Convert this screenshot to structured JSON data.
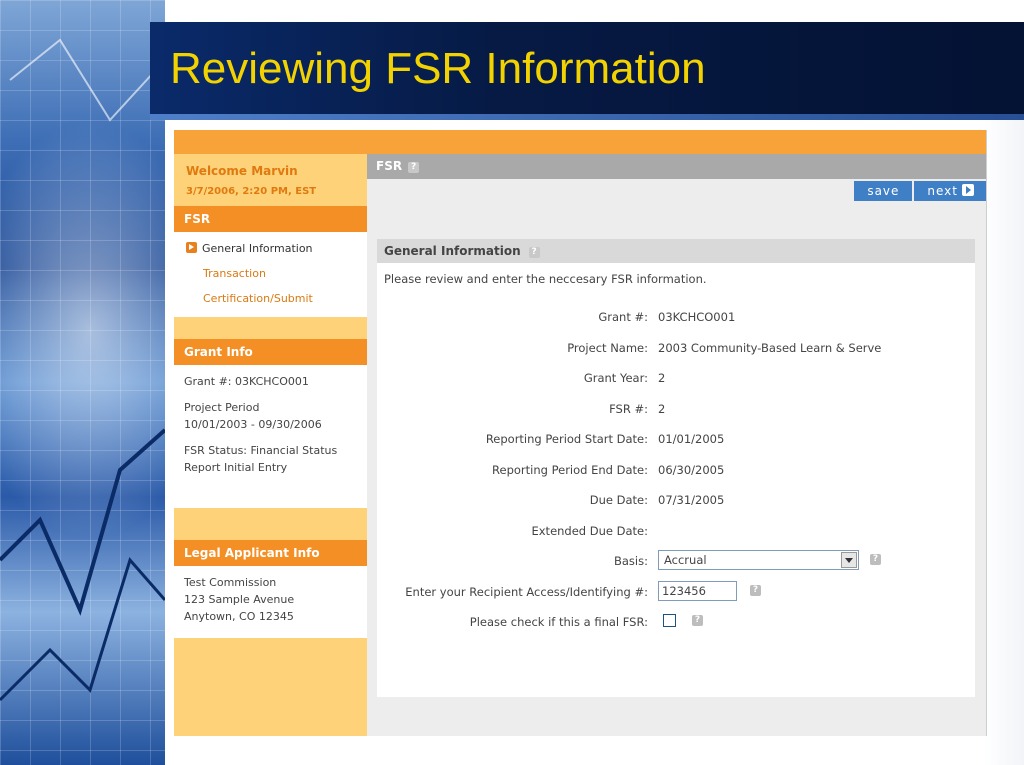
{
  "slide": {
    "title": "Reviewing FSR Information"
  },
  "sidebar": {
    "welcome": "Welcome Marvin",
    "datetime": "3/7/2006, 2:20 PM, EST",
    "fsr_header": "FSR",
    "nav": [
      {
        "label": "General Information",
        "active": true
      },
      {
        "label": "Transaction",
        "active": false
      },
      {
        "label": "Certification/Submit",
        "active": false
      }
    ],
    "grant_header": "Grant Info",
    "grant_lines": {
      "grant": "Grant #: 03KCHCO001",
      "period_label": "Project Period",
      "period_value": "10/01/2003 - 09/30/2006",
      "status_1": "FSR Status: Financial Status",
      "status_2": "Report Initial Entry"
    },
    "legal_header": "Legal Applicant Info",
    "legal_lines": [
      "Test Commission",
      "123 Sample Avenue",
      "Anytown, CO 12345"
    ]
  },
  "main": {
    "bar_title": "FSR",
    "help_glyph": "?",
    "save_label": "save",
    "next_label": "next",
    "panel_title": "General Information",
    "intro": "Please review and enter the neccesary FSR information.",
    "fields": [
      {
        "label": "Grant #:",
        "value": "03KCHCO001"
      },
      {
        "label": "Project Name:",
        "value": "2003 Community-Based Learn & Serve"
      },
      {
        "label": "Grant Year:",
        "value": "2"
      },
      {
        "label": "FSR #:",
        "value": "2"
      },
      {
        "label": "Reporting Period Start Date:",
        "value": "01/01/2005"
      },
      {
        "label": "Reporting Period End Date:",
        "value": "06/30/2005"
      },
      {
        "label": "Due Date:",
        "value": "07/31/2005"
      },
      {
        "label": "Extended Due Date:",
        "value": ""
      }
    ],
    "basis": {
      "label": "Basis:",
      "value": "Accrual"
    },
    "recipient": {
      "label": "Enter your Recipient Access/Identifying #:",
      "value": "123456"
    },
    "final": {
      "label": "Please check if this a final FSR:",
      "checked": false
    }
  },
  "colors": {
    "accent": "#f48f25",
    "title": "#f2d200",
    "button": "#3f7fc6"
  }
}
